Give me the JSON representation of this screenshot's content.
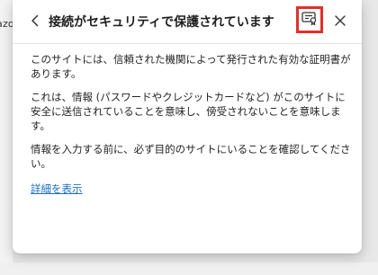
{
  "background": {
    "left_text": "azo"
  },
  "popup": {
    "title": "接続がセキュリティで保護されています",
    "paragraphs": [
      "このサイトには、信頼された機関によって発行された有効な証明書があります。",
      "これは、情報 (パスワードやクレジットカードなど) がこのサイトに安全に送信されていることを意味し、傍受されないことを意味します。",
      "情報を入力する前に、必ず目的のサイトにいることを確認してください。"
    ],
    "details_link": "詳細を表示",
    "icons": {
      "back": "chevron-left-icon",
      "certificate": "certificate-icon",
      "close": "close-icon"
    },
    "highlight_color": "#e0302b",
    "link_color": "#1a6dc9"
  }
}
